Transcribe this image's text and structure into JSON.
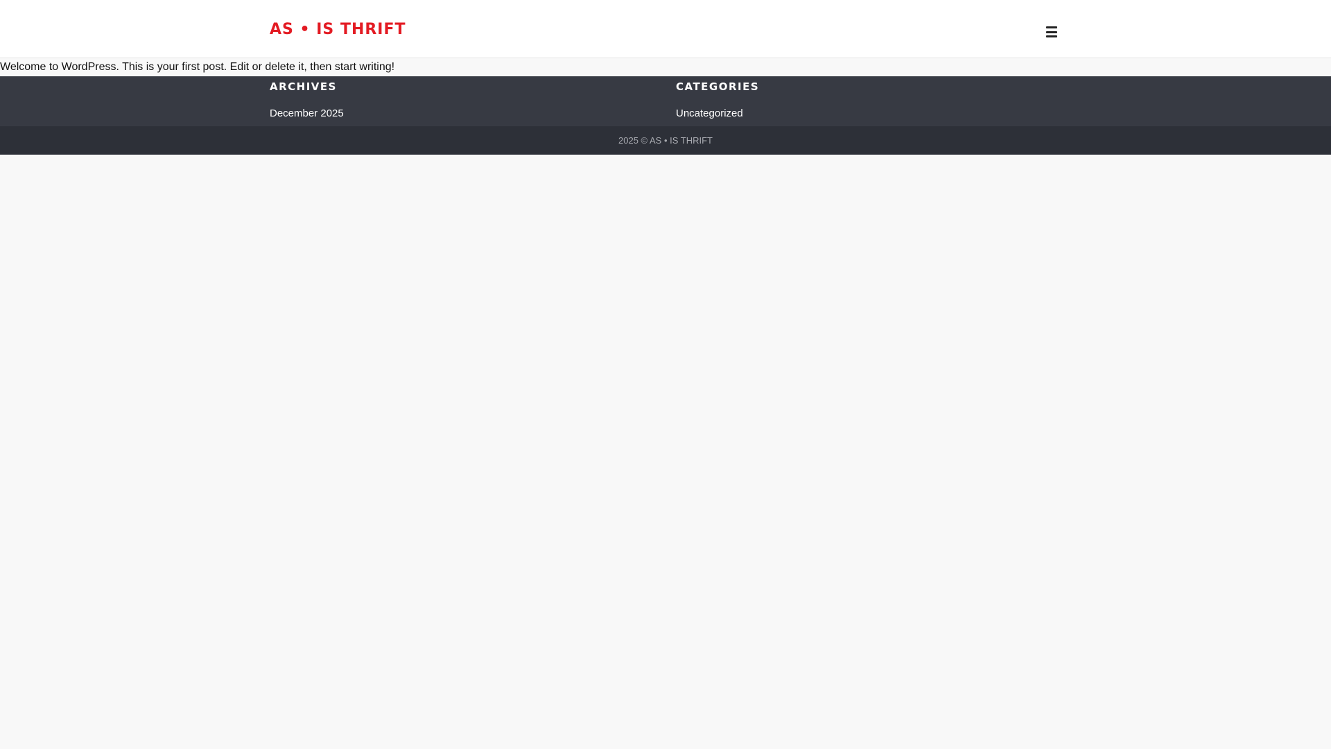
{
  "header": {
    "logo_text": "AS • IS THRIFT",
    "menu_icon": "hamburger-menu-icon"
  },
  "post": {
    "text": "Welcome to WordPress. This is your first post. Edit or delete it, then start writing!"
  },
  "widgets": {
    "archives": {
      "title": "ARCHIVES",
      "items": [
        {
          "label": "December 2025"
        }
      ]
    },
    "categories": {
      "title": "CATEGORIES",
      "items": [
        {
          "label": "Uncategorized"
        }
      ]
    }
  },
  "footer": {
    "copyright": "2025 © AS • IS THRIFT"
  },
  "colors": {
    "brand": "#e31b23",
    "widget_bg": "#373a43",
    "footer_bg": "#2d3038",
    "page_bg": "#f8f8f8"
  }
}
